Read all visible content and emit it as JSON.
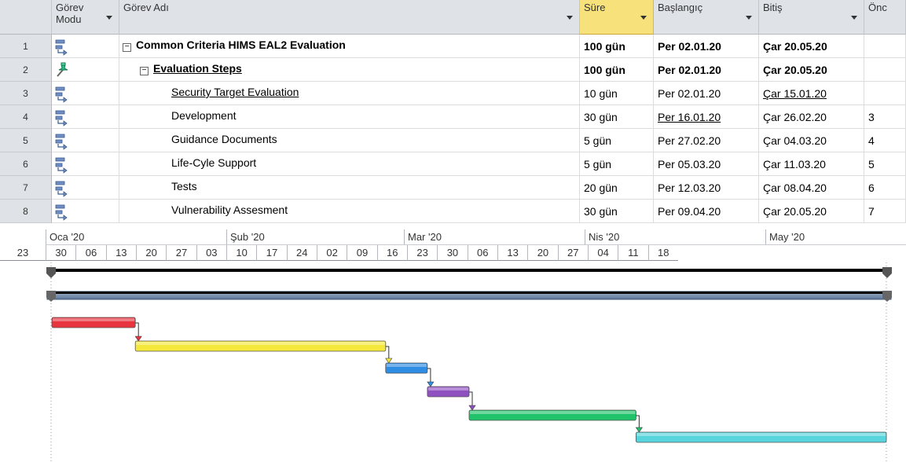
{
  "columns": {
    "mode": "Görev Modu",
    "name": "Görev Adı",
    "duration": "Süre",
    "start": "Başlangıç",
    "finish": "Bitiş",
    "pred": "Önc"
  },
  "rows": [
    {
      "id": "1",
      "mode": "auto",
      "name": "Common Criteria HIMS EAL2 Evaluation",
      "duration": "100 gün",
      "start": "Per 02.01.20",
      "finish": "Çar 20.05.20",
      "pred": "",
      "level": 0,
      "summary": true,
      "bold": true,
      "collapsible": true
    },
    {
      "id": "2",
      "mode": "manual",
      "name": "Evaluation Steps",
      "duration": "100 gün",
      "start": "Per 02.01.20",
      "finish": "Çar 20.05.20",
      "pred": "",
      "level": 1,
      "summary": true,
      "bold": true,
      "underline": true,
      "collapsible": true
    },
    {
      "id": "3",
      "mode": "auto",
      "name": "Security Target Evaluation",
      "duration": "10 gün",
      "start": "Per 02.01.20",
      "finish": "Çar 15.01.20",
      "pred": "",
      "level": 2,
      "underline": true,
      "finish_underline": true
    },
    {
      "id": "4",
      "mode": "auto",
      "name": "Development",
      "duration": "30 gün",
      "start": "Per 16.01.20",
      "finish": "Çar 26.02.20",
      "pred": "3",
      "level": 2,
      "start_underline": true
    },
    {
      "id": "5",
      "mode": "auto",
      "name": "Guidance Documents",
      "duration": "5 gün",
      "start": "Per 27.02.20",
      "finish": "Çar 04.03.20",
      "pred": "4",
      "level": 2
    },
    {
      "id": "6",
      "mode": "auto",
      "name": "Life-Cyle Support",
      "duration": "5 gün",
      "start": "Per 05.03.20",
      "finish": "Çar 11.03.20",
      "pred": "5",
      "level": 2
    },
    {
      "id": "7",
      "mode": "auto",
      "name": "Tests",
      "duration": "20 gün",
      "start": "Per 12.03.20",
      "finish": "Çar 08.04.20",
      "pred": "6",
      "level": 2
    },
    {
      "id": "8",
      "mode": "auto",
      "name": "Vulnerability Assesment",
      "duration": "30 gün",
      "start": "Per 09.04.20",
      "finish": "Çar 20.05.20",
      "pred": "7",
      "level": 2
    }
  ],
  "timescale": {
    "months": [
      "Oca '20",
      "Şub '20",
      "Mar '20",
      "Nis '20",
      "May '20"
    ],
    "weeks": [
      "23",
      "30",
      "06",
      "13",
      "20",
      "27",
      "03",
      "10",
      "17",
      "24",
      "02",
      "09",
      "16",
      "23",
      "30",
      "06",
      "13",
      "20",
      "27",
      "04",
      "11",
      "18"
    ]
  },
  "gantt": {
    "tasks": [
      {
        "row": 1,
        "type": "summary"
      },
      {
        "row": 2,
        "type": "manual-summary"
      },
      {
        "row": 3,
        "type": "task",
        "color": "#e8343f"
      },
      {
        "row": 4,
        "type": "task",
        "color": "#f5e83c"
      },
      {
        "row": 5,
        "type": "task",
        "color": "#2f8de4"
      },
      {
        "row": 6,
        "type": "task",
        "color": "#9051c0"
      },
      {
        "row": 7,
        "type": "task",
        "color": "#21c36a"
      },
      {
        "row": 8,
        "type": "task",
        "color": "#58d4dc"
      }
    ]
  },
  "colors": {
    "selected_header": "#f7e17a",
    "header": "#dfe3e8"
  },
  "icons": {
    "auto": "auto-scheduled-task-icon",
    "manual": "manually-scheduled-pin-icon"
  }
}
